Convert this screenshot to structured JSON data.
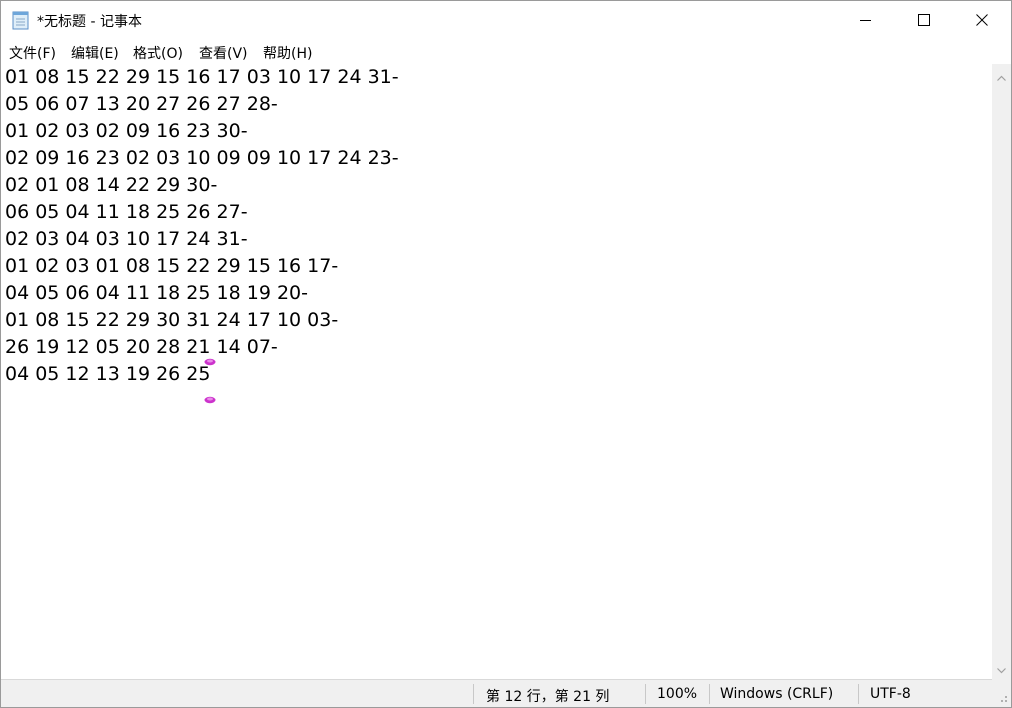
{
  "window": {
    "title": "*无标题 - 记事本"
  },
  "menu": [
    {
      "label": "文件(F)"
    },
    {
      "label": "编辑(E)"
    },
    {
      "label": "格式(O)"
    },
    {
      "label": "查看(V)"
    },
    {
      "label": "帮助(H)"
    }
  ],
  "editor": {
    "lines": [
      "01 08 15 22 29 15 16 17 03 10 17 24 31-",
      "05 06 07 13 20 27 26 27 28-",
      "01 02 03 02 09 16 23 30-",
      "02 09 16 23 02 03 10 09 09 10 17 24 23-",
      "02 01 08 14 22 29 30-",
      "06 05 04 11 18 25 26 27-",
      "02 03 04 03 10 17 24 31-",
      "01 02 03 01 08 15 22 29 15 16 17-",
      "04 05 06 04 11 18 25 18 19 20-",
      "01 08 15 22 29 30 31 24 17 10 03-",
      "26 19 12 05 20 28 21 14 07-",
      "04 05 12 13 19 26 25"
    ]
  },
  "status": {
    "position": "第 12 行，第 21 列",
    "zoom": "100%",
    "line_ending": "Windows (CRLF)",
    "encoding": "UTF-8"
  },
  "colors": {
    "accent_marker": "#cc33cc",
    "statusbar_bg": "#f0f0f0"
  },
  "icons": [
    "notepad-icon",
    "minimize-icon",
    "maximize-icon",
    "close-icon",
    "scroll-up-arrow-icon",
    "scroll-down-arrow-icon",
    "resize-grip-icon"
  ]
}
